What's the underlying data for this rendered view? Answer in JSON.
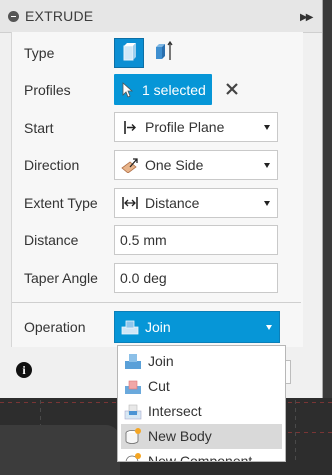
{
  "panel": {
    "title": "EXTRUDE"
  },
  "rows": {
    "type_label": "Type",
    "profiles_label": "Profiles",
    "profiles_value": "1 selected",
    "start_label": "Start",
    "start_value": "Profile Plane",
    "direction_label": "Direction",
    "direction_value": "One Side",
    "extent_label": "Extent Type",
    "extent_value": "Distance",
    "distance_label": "Distance",
    "distance_value": "0.5 mm",
    "taper_label": "Taper Angle",
    "taper_value": "0.0 deg",
    "operation_label": "Operation",
    "operation_value": "Join"
  },
  "operation_menu": {
    "items": [
      {
        "label": "Join",
        "icon": "join-icon"
      },
      {
        "label": "Cut",
        "icon": "cut-icon"
      },
      {
        "label": "Intersect",
        "icon": "intersect-icon"
      },
      {
        "label": "New Body",
        "icon": "new-body-icon",
        "highlighted": true
      },
      {
        "label": "New Component",
        "icon": "new-component-icon"
      }
    ]
  },
  "colors": {
    "accent": "#0696d7",
    "panel_bg": "#f0f0f0",
    "canvas_bg": "#2d2d2d"
  }
}
